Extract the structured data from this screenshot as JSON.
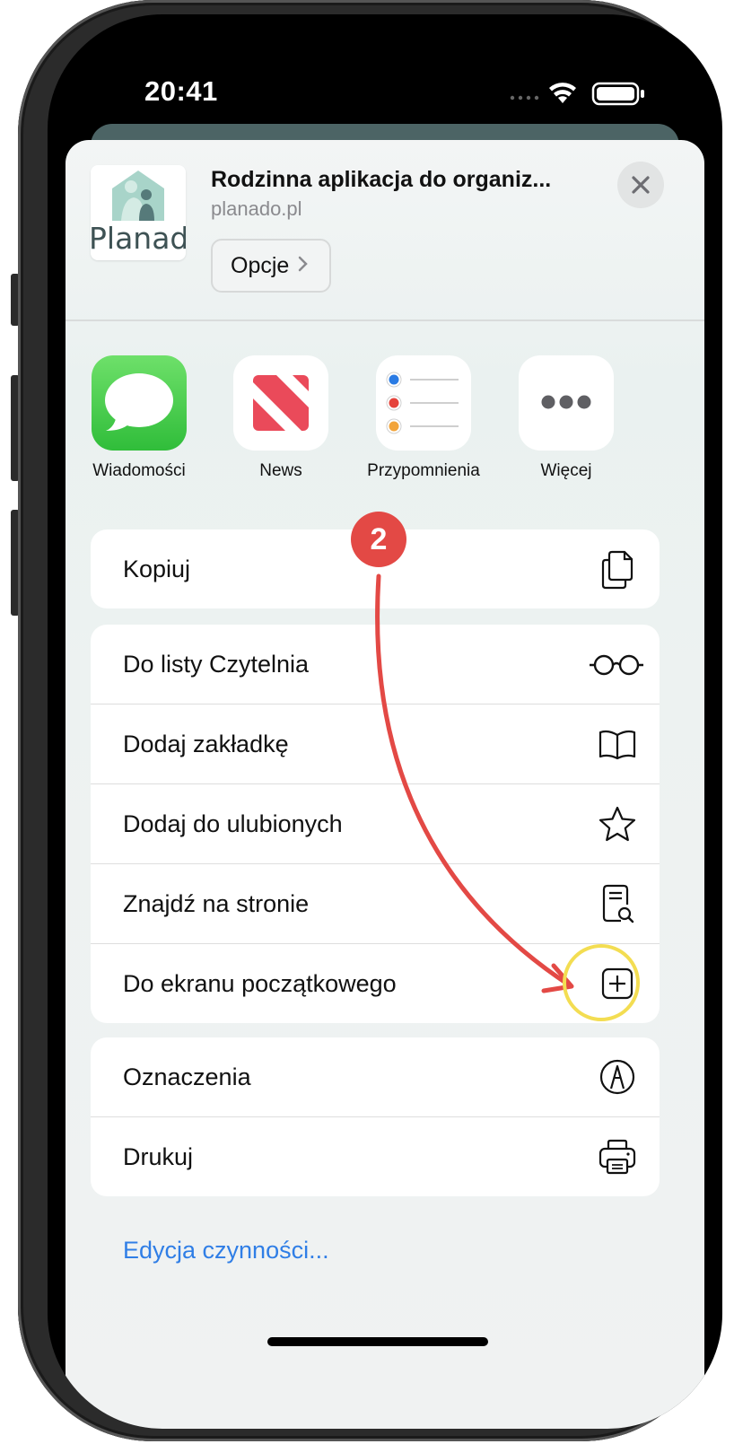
{
  "status": {
    "time": "20:41"
  },
  "header": {
    "title": "Rodzinna aplikacja do organiz...",
    "url": "planado.pl",
    "options_label": "Opcje",
    "brand_name": "Planado"
  },
  "apps": [
    {
      "label": "Wiadomości",
      "icon": "messages-icon"
    },
    {
      "label": "News",
      "icon": "news-icon"
    },
    {
      "label": "Przypomnienia",
      "icon": "reminders-icon"
    },
    {
      "label": "Więcej",
      "icon": "more-icon"
    }
  ],
  "actions": {
    "copy": "Kopiuj",
    "reading_list": "Do listy Czytelnia",
    "add_bookmark": "Dodaj zakładkę",
    "add_favorites": "Dodaj do ulubionych",
    "find_on_page": "Znajdź na stronie",
    "add_home_screen": "Do ekranu początkowego",
    "markup": "Oznaczenia",
    "print": "Drukuj"
  },
  "edit_actions": "Edycja czynności...",
  "annotation": {
    "step": "2"
  },
  "colors": {
    "accent_link": "#2f7ee6",
    "annotation_red": "#e34945",
    "highlight_yellow": "#f3dd52",
    "messages_green": "#4cd964"
  }
}
